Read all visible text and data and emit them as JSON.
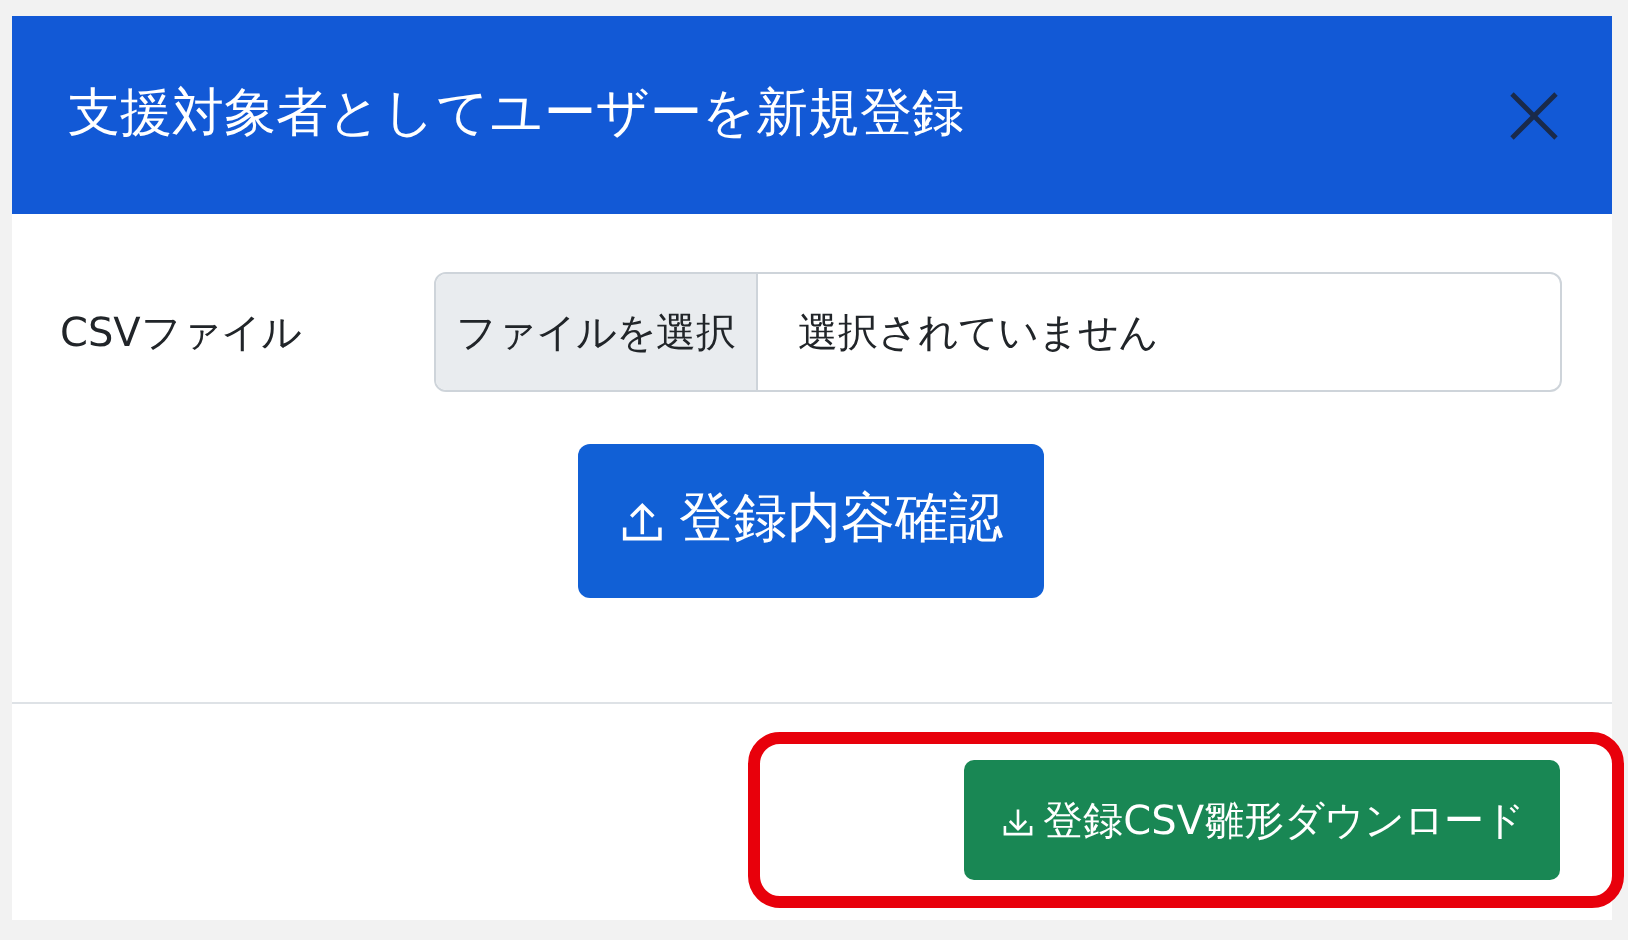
{
  "dialog": {
    "title": "支援対象者としてユーザーを新規登録",
    "fields": [
      {
        "label": "CSVファイル",
        "kind": "file",
        "button": "ファイルを選択",
        "value": "選択されていません"
      }
    ],
    "primary_action": {
      "label": "登録内容確認",
      "kind": "upload"
    },
    "footer_action": {
      "label": "登録CSV雛形ダウンロード",
      "kind": "download",
      "highlighted": true
    }
  }
}
